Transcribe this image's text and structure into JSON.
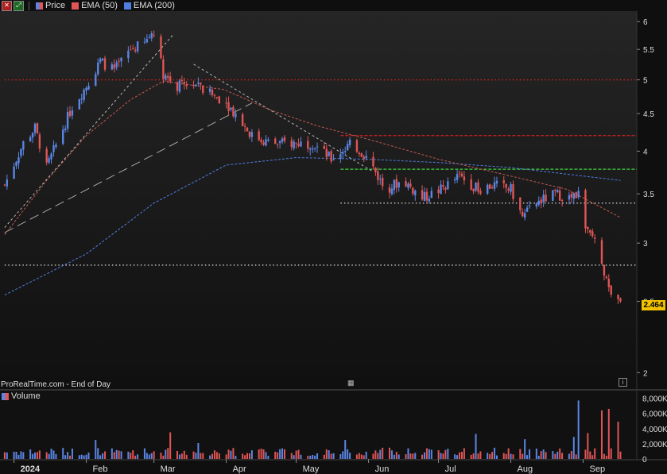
{
  "legend": {
    "close_icon": "close-icon",
    "expand_icon": "expand-icon",
    "price_label": "Price",
    "ema50_label": "EMA (50)",
    "ema200_label": "EMA (200)"
  },
  "colors": {
    "up": "#5b86e5",
    "down": "#e05555",
    "ema50": "#c0584f",
    "ema200": "#4e7fe0",
    "price_tag": "#f2c200"
  },
  "footer": {
    "source": "ProRealTime.com - End of Day"
  },
  "volume_label": "Volume",
  "last_price": "2.464",
  "chart_data": {
    "type": "candlestick",
    "scale": "log",
    "ylim": [
      1.9,
      6.2
    ],
    "yticks": [
      "6",
      "5.5",
      "5",
      "4.5",
      "4",
      "3.5",
      "3",
      "2.5",
      "2"
    ],
    "x_labels": [
      "2024",
      "Feb",
      "Mar",
      "Apr",
      "May",
      "Jun",
      "Jul",
      "Aug",
      "Sep"
    ],
    "volume_ticks": [
      "8,000K",
      "6,000K",
      "4,000K",
      "2,000K",
      "0"
    ],
    "volume_ylim": [
      0,
      9000
    ],
    "price_path": [
      [
        "2023-12-28",
        3.6
      ],
      [
        "2024-01-05",
        4.1
      ],
      [
        "2024-01-10",
        4.3
      ],
      [
        "2024-01-15",
        3.8
      ],
      [
        "2024-01-20",
        4.15
      ],
      [
        "2024-01-26",
        4.6
      ],
      [
        "2024-02-01",
        4.9
      ],
      [
        "2024-02-07",
        5.3
      ],
      [
        "2024-02-13",
        5.15
      ],
      [
        "2024-02-20",
        5.5
      ],
      [
        "2024-02-26",
        5.6
      ],
      [
        "2024-03-01",
        5.85
      ],
      [
        "2024-03-05",
        5.1
      ],
      [
        "2024-03-11",
        4.9
      ],
      [
        "2024-03-17",
        4.95
      ],
      [
        "2024-03-24",
        4.8
      ],
      [
        "2024-03-31",
        4.7
      ],
      [
        "2024-04-06",
        4.45
      ],
      [
        "2024-04-12",
        4.2
      ],
      [
        "2024-04-20",
        4.1
      ],
      [
        "2024-04-30",
        4.1
      ],
      [
        "2024-05-08",
        4.1
      ],
      [
        "2024-05-16",
        3.9
      ],
      [
        "2024-05-25",
        4.1
      ],
      [
        "2024-06-01",
        3.9
      ],
      [
        "2024-06-08",
        3.55
      ],
      [
        "2024-06-16",
        3.65
      ],
      [
        "2024-06-24",
        3.45
      ],
      [
        "2024-07-02",
        3.55
      ],
      [
        "2024-07-10",
        3.7
      ],
      [
        "2024-07-18",
        3.55
      ],
      [
        "2024-07-25",
        3.6
      ],
      [
        "2024-08-01",
        3.55
      ],
      [
        "2024-08-06",
        3.25
      ],
      [
        "2024-08-12",
        3.4
      ],
      [
        "2024-08-20",
        3.5
      ],
      [
        "2024-08-27",
        3.45
      ],
      [
        "2024-08-30",
        3.5
      ],
      [
        "2024-09-02",
        3.1
      ],
      [
        "2024-09-06",
        3.05
      ],
      [
        "2024-09-10",
        2.7
      ],
      [
        "2024-09-14",
        2.5
      ],
      [
        "2024-09-17",
        2.464
      ]
    ],
    "ema50_path": [
      [
        "2023-12-28",
        3.08
      ],
      [
        "2024-01-15",
        3.65
      ],
      [
        "2024-02-01",
        4.2
      ],
      [
        "2024-02-20",
        4.7
      ],
      [
        "2024-03-05",
        4.98
      ],
      [
        "2024-03-31",
        4.85
      ],
      [
        "2024-04-20",
        4.55
      ],
      [
        "2024-05-10",
        4.33
      ],
      [
        "2024-06-01",
        4.15
      ],
      [
        "2024-07-01",
        3.9
      ],
      [
        "2024-08-01",
        3.7
      ],
      [
        "2024-08-25",
        3.55
      ],
      [
        "2024-09-17",
        3.25
      ]
    ],
    "ema200_path": [
      [
        "2023-12-28",
        2.55
      ],
      [
        "2024-02-01",
        2.9
      ],
      [
        "2024-03-01",
        3.4
      ],
      [
        "2024-04-01",
        3.83
      ],
      [
        "2024-05-01",
        3.92
      ],
      [
        "2024-06-01",
        3.9
      ],
      [
        "2024-07-01",
        3.86
      ],
      [
        "2024-08-01",
        3.8
      ],
      [
        "2024-09-17",
        3.65
      ]
    ],
    "horizontal_levels": [
      {
        "value": 5.0,
        "style": "dotted",
        "color": "#e02020",
        "from": "2023-12-28"
      },
      {
        "value": 4.2,
        "style": "dashed",
        "color": "#d02020",
        "from": "2024-05-20"
      },
      {
        "value": 3.78,
        "style": "dashed",
        "color": "#3fcf3f",
        "from": "2024-05-20"
      },
      {
        "value": 3.4,
        "style": "dotted",
        "color": "#cccccc",
        "from": "2024-05-20"
      },
      {
        "value": 2.8,
        "style": "dotted",
        "color": "#cccccc",
        "from": "2023-12-28"
      }
    ],
    "trendlines": [
      {
        "from": [
          "2023-12-28",
          3.15
        ],
        "to": [
          "2024-03-09",
          5.75
        ],
        "color": "#cfcfcf",
        "style": "dashed"
      },
      {
        "from": [
          "2023-12-28",
          3.1
        ],
        "to": [
          "2024-04-12",
          4.65
        ],
        "color": "#bfbfbf",
        "style": "longdash"
      },
      {
        "from": [
          "2024-03-18",
          5.25
        ],
        "to": [
          "2024-06-03",
          3.75
        ],
        "color": "#cfcfcf",
        "style": "dashed"
      }
    ],
    "volume_spikes": [
      [
        "2024-01-20",
        4200
      ],
      [
        "2024-02-05",
        2500
      ],
      [
        "2024-03-08",
        3500
      ],
      [
        "2024-03-20",
        2100
      ],
      [
        "2024-05-22",
        2500
      ],
      [
        "2024-07-17",
        3300
      ],
      [
        "2024-08-07",
        2600
      ],
      [
        "2024-08-28",
        2900
      ],
      [
        "2024-08-30",
        7700
      ],
      [
        "2024-09-03",
        3400
      ],
      [
        "2024-09-09",
        6400
      ],
      [
        "2024-09-12",
        6600
      ],
      [
        "2024-09-15",
        6500
      ],
      [
        "2024-09-16",
        4900
      ]
    ]
  }
}
